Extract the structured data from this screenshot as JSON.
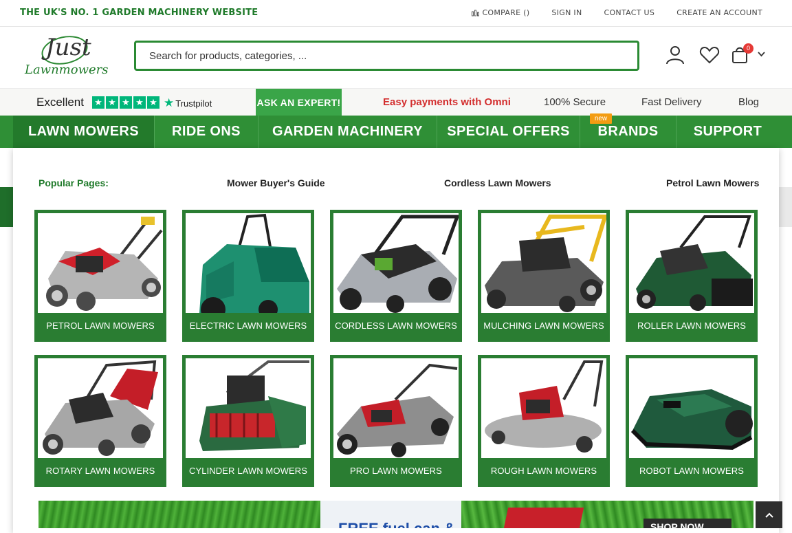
{
  "topbar": {
    "tagline": "THE UK'S NO. 1 GARDEN MACHINERY WEBSITE",
    "compare": "COMPARE ()",
    "sign_in": "SIGN IN",
    "contact_us": "CONTACT US",
    "create_account": "CREATE AN ACCOUNT"
  },
  "logo": {
    "line1": "Just",
    "line2": "Lawnmowers"
  },
  "search": {
    "placeholder": "Search for products, categories, ..."
  },
  "cart": {
    "count": "0"
  },
  "strip": {
    "rating_word": "Excellent",
    "trustpilot": "Trustpilot",
    "ask_expert": "ASK AN EXPERT!",
    "omni": "Easy payments with Omni",
    "secure": "100% Secure",
    "delivery": "Fast Delivery",
    "blog": "Blog"
  },
  "nav": {
    "items": [
      "LAWN MOWERS",
      "RIDE ONS",
      "GARDEN MACHINERY",
      "SPECIAL OFFERS",
      "BRANDS",
      "SUPPORT"
    ],
    "new_badge": "new"
  },
  "dropdown": {
    "popular_label": "Popular Pages:",
    "popular_links": [
      "Mower Buyer's Guide",
      "Cordless Lawn Mowers",
      "Petrol Lawn Mowers"
    ],
    "categories": [
      "PETROL LAWN MOWERS",
      "ELECTRIC LAWN MOWERS",
      "CORDLESS LAWN MOWERS",
      "MULCHING LAWN MOWERS",
      "ROLLER LAWN MOWERS",
      "ROTARY LAWN MOWERS",
      "CYLINDER LAWN MOWERS",
      "PRO LAWN MOWERS",
      "ROUGH LAWN MOWERS",
      "ROBOT LAWN MOWERS"
    ]
  },
  "banner": {
    "headline": "FREE fuel can &",
    "shop_now": "SHOP NOW"
  },
  "colors": {
    "brand_green": "#2f8f36",
    "accent_red": "#d32f2f",
    "trustpilot_green": "#00b67a"
  }
}
